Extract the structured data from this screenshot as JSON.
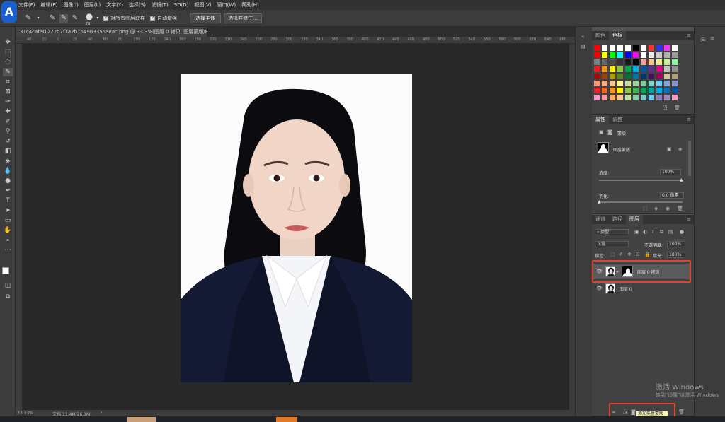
{
  "app": {
    "logo_letter": "A"
  },
  "menu": [
    "文件(F)",
    "编辑(E)",
    "图像(I)",
    "图层(L)",
    "文字(Y)",
    "选择(S)",
    "滤镜(T)",
    "3D(D)",
    "视图(V)",
    "窗口(W)",
    "帮助(H)"
  ],
  "options_bar": {
    "brush_size": "78",
    "sample_all_layers": "对所有图层取样",
    "auto_enhance": "自动增强",
    "select_subject": "选择主体",
    "select_and_mask": "选择并遮住..."
  },
  "document": {
    "tab_title": "31c4cab91222b7f1a2b164963355aeac.png @ 33.3%(图层 0 拷贝, 图层蒙版/8) *",
    "zoom": "33.33%",
    "doc_info": "文档:11.4M/26.3M"
  },
  "rulers": {
    "top": [
      "40",
      "20",
      "0",
      "20",
      "40",
      "60",
      "80",
      "100",
      "120",
      "140",
      "160",
      "180",
      "200",
      "220",
      "240",
      "260",
      "280",
      "300",
      "320",
      "340",
      "360",
      "380",
      "400",
      "420",
      "440",
      "460",
      "480",
      "500",
      "520",
      "540",
      "560",
      "580",
      "600",
      "620",
      "640",
      "660"
    ]
  },
  "swatches_panel": {
    "tabs": [
      "颜色",
      "色板"
    ]
  },
  "properties_panel": {
    "tabs": [
      "属性",
      "调整"
    ],
    "mask_label": "蒙版",
    "layer_mask_label": "图层蒙版",
    "density_label": "浓度:",
    "density_value": "100%",
    "feather_label": "羽化:",
    "feather_value": "0.0 像素"
  },
  "layers_panel": {
    "tabs": [
      "通道",
      "路径",
      "图层"
    ],
    "filter_kind": "类型",
    "blend_mode": "正常",
    "opacity_label": "不透明度:",
    "opacity_value": "100%",
    "lock_label": "锁定:",
    "fill_label": "填充:",
    "fill_value": "100%",
    "layers": [
      {
        "name": "图层 0 拷贝"
      },
      {
        "name": "图层 0"
      }
    ],
    "tooltip": "添加矢量蒙版",
    "fx_label": "fx"
  },
  "windows_watermark": {
    "line1": "激活 Windows",
    "line2": "转到\"设置\"以激活 Windows"
  },
  "colors": {
    "suit": "#141a33",
    "hair": "#0c0c10",
    "skin": "#f1d6c7",
    "highlight_box": "#e0412f"
  }
}
